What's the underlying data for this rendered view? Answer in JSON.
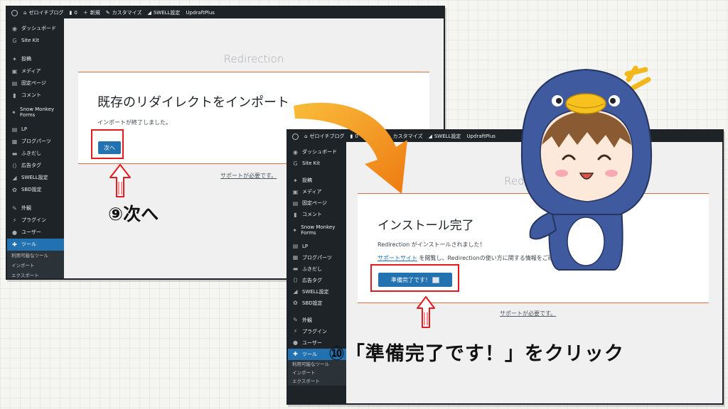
{
  "admin_bar": {
    "site_name": "ゼロイチブログ",
    "comments_count": "0",
    "new_label": "新規",
    "customize_label": "カスタマイズ",
    "swell_label": "SWELL設定",
    "updraft_label": "UpdraftPlus"
  },
  "sidebar": {
    "items": [
      {
        "label": "ダッシュボード",
        "icon": "dashboard-icon"
      },
      {
        "label": "Site Kit",
        "icon": "sitekit-icon"
      },
      {
        "label": "投稿",
        "icon": "pin-icon"
      },
      {
        "label": "メディア",
        "icon": "media-icon"
      },
      {
        "label": "固定ページ",
        "icon": "page-icon"
      },
      {
        "label": "コメント",
        "icon": "comment-icon"
      },
      {
        "label": "Snow Monkey Forms",
        "icon": "pin-icon"
      },
      {
        "label": "LP",
        "icon": "page-icon"
      },
      {
        "label": "ブログパーツ",
        "icon": "blocks-icon"
      },
      {
        "label": "ふきだし",
        "icon": "bubble-icon"
      },
      {
        "label": "広告タグ",
        "icon": "code-icon"
      },
      {
        "label": "SWELL設定",
        "icon": "swell-icon"
      },
      {
        "label": "SBD設定",
        "icon": "gear-icon"
      },
      {
        "label": "外観",
        "icon": "brush-icon"
      },
      {
        "label": "プラグイン",
        "icon": "plugin-icon"
      },
      {
        "label": "ユーザー",
        "icon": "user-icon"
      },
      {
        "label": "ツール",
        "icon": "wrench-icon"
      }
    ],
    "submenu": [
      "利用可能なツール",
      "インポート",
      "エクスポート"
    ]
  },
  "screen1": {
    "plugin_title": "Redirection",
    "heading": "既存のリダイレクトをインポート",
    "message": "インポートが終了しました。",
    "next_button": "次へ",
    "support_link": "サポートが必要です。"
  },
  "screen2": {
    "plugin_title": "Redirection",
    "heading": "インストール完了",
    "message": "Redirection がインストールされました！",
    "support_site_link": "サポートサイト",
    "info_text": " を閲覧し、Redirectionの使い方に関する情報をご確認ください。",
    "ready_button": "準備完了です！",
    "support_link": "サポートが必要です。"
  },
  "captions": {
    "step9": "⑨次へ",
    "step10": "⑩「準備完了です！」をクリック"
  },
  "colors": {
    "wp_admin_bg": "#1d2327",
    "wp_blue": "#2271b1",
    "highlight_red": "#e5191e",
    "divider_orange": "#d36f3c",
    "arrow_orange": "#f39a1e"
  }
}
